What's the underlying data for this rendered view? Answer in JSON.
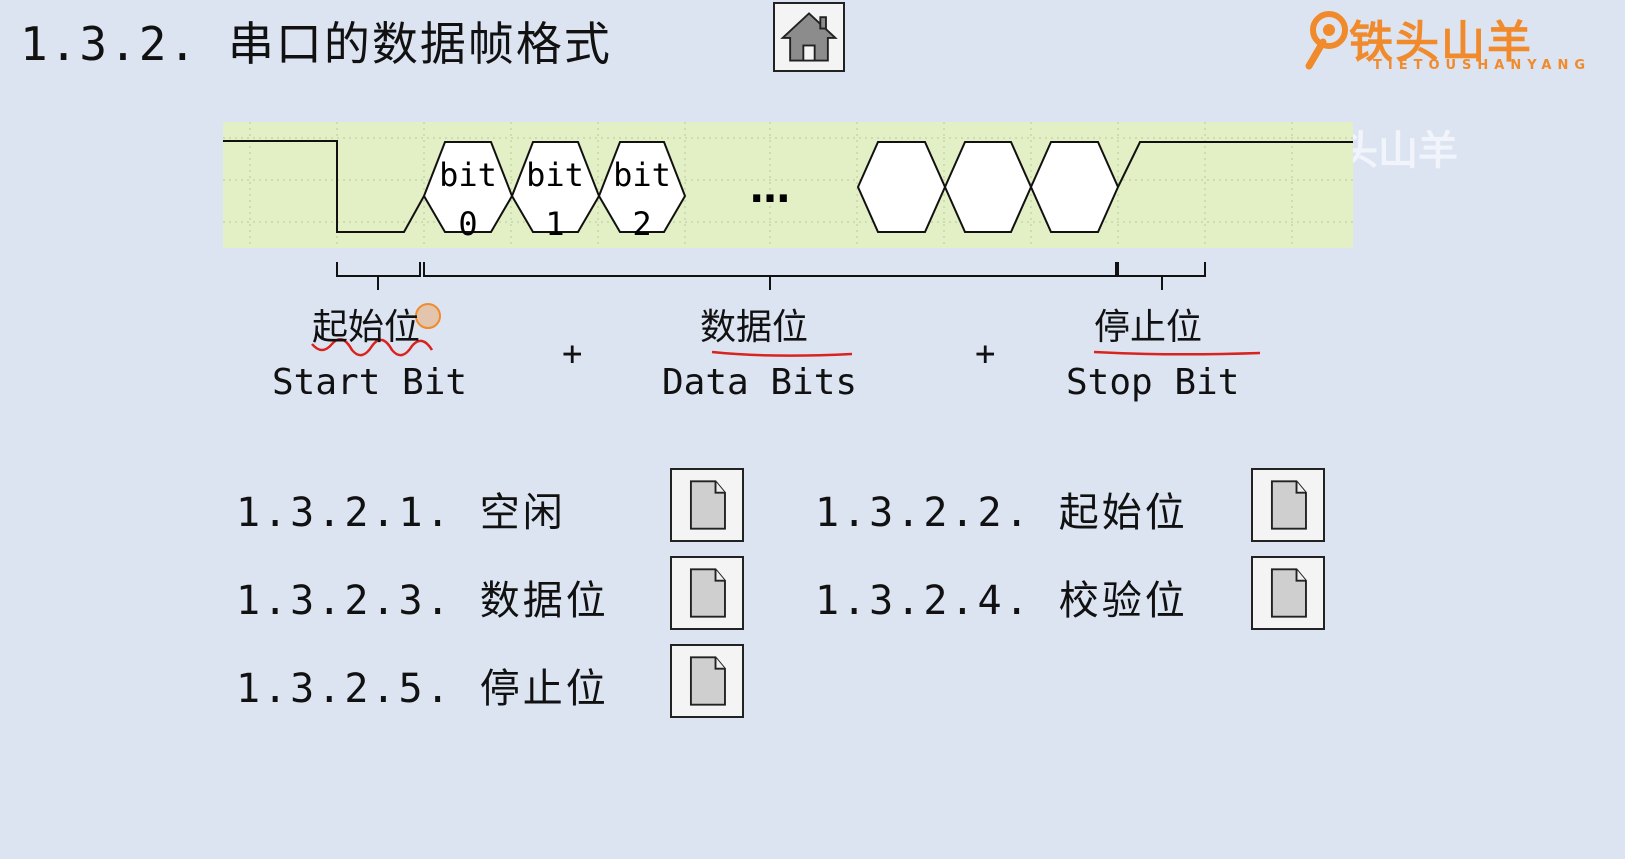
{
  "header": {
    "title": "1.3.2.  串口的数据帧格式",
    "home_icon": "home-icon"
  },
  "logo": {
    "name": "铁头山羊",
    "sub": "TIETOUSHANYANG",
    "watermark": "@铁头山羊"
  },
  "waveform": {
    "bits": [
      {
        "top": "bit",
        "bottom": "0"
      },
      {
        "top": "bit",
        "bottom": "1"
      },
      {
        "top": "bit",
        "bottom": "2"
      }
    ],
    "ellipsis": "…",
    "colors": {
      "band": "#e3efc4",
      "grid": "#b9c9a3",
      "line": "#111111",
      "annotation": "#d9231f"
    }
  },
  "fields": {
    "start": {
      "cn": "起始位",
      "en": "Start Bit"
    },
    "data": {
      "cn": "数据位",
      "en": "Data Bits"
    },
    "stop": {
      "cn": "停止位",
      "en": "Stop Bit"
    },
    "plus": "+"
  },
  "sections": [
    {
      "label": "1.3.2.1.  空闲",
      "icon": "document-icon"
    },
    {
      "label": "1.3.2.2.  起始位",
      "icon": "document-icon"
    },
    {
      "label": "1.3.2.3.  数据位",
      "icon": "document-icon"
    },
    {
      "label": "1.3.2.4.  校验位",
      "icon": "document-icon"
    },
    {
      "label": "1.3.2.5.  停止位",
      "icon": "document-icon"
    }
  ]
}
